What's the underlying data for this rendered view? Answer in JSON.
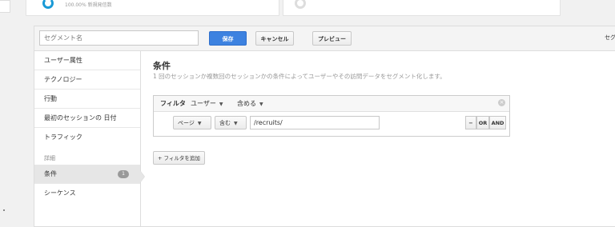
{
  "top_strip": {
    "metric_note": "100.00% 新規発信数"
  },
  "toolbar": {
    "segment_name_placeholder": "セグメント名",
    "save_label": "保存",
    "cancel_label": "キャンセル",
    "preview_label": "プレビュー",
    "right_clip": "セグ"
  },
  "sidebar": {
    "items": [
      {
        "label": "ユーザー属性"
      },
      {
        "label": "テクノロジー"
      },
      {
        "label": "行動"
      },
      {
        "label": "最初のセッションの 日付"
      },
      {
        "label": "トラフィック"
      }
    ],
    "section_label": "詳細",
    "advanced_items": [
      {
        "label": "条件",
        "badge": "1"
      },
      {
        "label": "シーケンス"
      }
    ]
  },
  "main": {
    "title": "条件",
    "description": "1 回のセッションか複数回のセッションかの条件によってユーザーやその訪問データをセグメント化します。",
    "filter": {
      "label": "フィルタ",
      "scope": "ユーザー",
      "mode": "含める",
      "dimension": "ページ",
      "operator": "含む",
      "value": "/recruits/",
      "minus_label": "−",
      "or_label": "OR",
      "and_label": "AND"
    },
    "add_filter_label": "+ フィルタを追加"
  },
  "colors": {
    "primary_button": "#3d82e0",
    "ring_accent": "#1a9ad6"
  }
}
